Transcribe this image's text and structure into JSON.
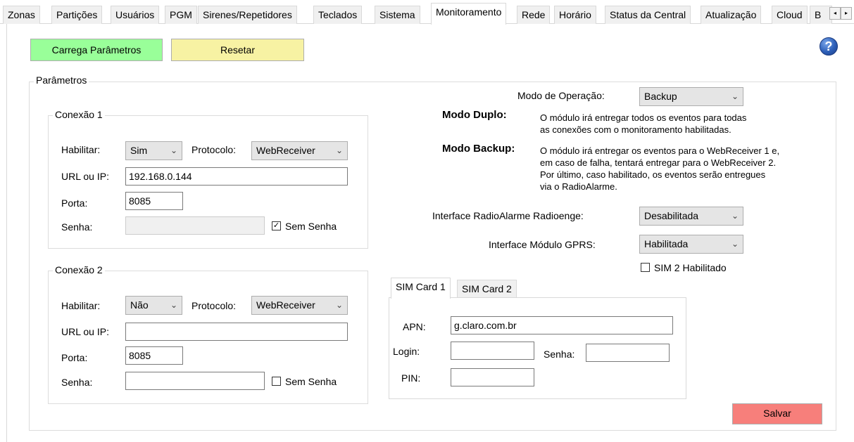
{
  "tabs": {
    "items": [
      "Zonas",
      "Partições",
      "Usuários",
      "PGM",
      "Sirenes/Repetidores",
      "Teclados",
      "Sistema",
      "Monitoramento",
      "Rede",
      "Horário",
      "Status da Central",
      "Atualização",
      "Cloud",
      "B"
    ],
    "active": "Monitoramento",
    "scroll_left": "◂",
    "scroll_right": "▸"
  },
  "toolbar": {
    "load_label": "Carrega Parâmetros",
    "reset_label": "Resetar",
    "help_label": "?"
  },
  "params": {
    "title": "Parâmetros"
  },
  "conn1": {
    "title": "Conexão 1",
    "enable_label": "Habilitar:",
    "enable_value": "Sim",
    "protocol_label": "Protocolo:",
    "protocol_value": "WebReceiver",
    "url_label": "URL ou IP:",
    "url_value": "192.168.0.144",
    "port_label": "Porta:",
    "port_value": "8085",
    "password_label": "Senha:",
    "password_value": "",
    "no_password_label": "Sem Senha",
    "no_password_checked": true
  },
  "conn2": {
    "title": "Conexão 2",
    "enable_label": "Habilitar:",
    "enable_value": "Não",
    "protocol_label": "Protocolo:",
    "protocol_value": "WebReceiver",
    "url_label": "URL ou IP:",
    "url_value": "",
    "port_label": "Porta:",
    "port_value": "8085",
    "password_label": "Senha:",
    "password_value": "",
    "no_password_label": "Sem Senha",
    "no_password_checked": false
  },
  "operation": {
    "mode_label": "Modo de Operação:",
    "mode_value": "Backup",
    "dual_title": "Modo Duplo:",
    "dual_line1": "O módulo irá entregar todos os eventos para todas",
    "dual_line2": "as conexões com o monitoramento habilitadas.",
    "backup_title": "Modo Backup:",
    "backup_line1": "O módulo irá entregar os eventos para o WebReceiver 1 e,",
    "backup_line2": "em caso de falha, tentará entregar para o WebReceiver 2.",
    "backup_line3": "Por último, caso habilitado, os eventos serão entregues",
    "backup_line4": "via o RadioAlarme."
  },
  "interfaces": {
    "radio_label": "Interface RadioAlarme Radioenge:",
    "radio_value": "Desabilitada",
    "gprs_label": "Interface Módulo GPRS:",
    "gprs_value": "Habilitada",
    "sim2_label": "SIM 2 Habilitado",
    "sim2_checked": false
  },
  "sim": {
    "tab1": "SIM Card 1",
    "tab2": "SIM Card 2",
    "apn_label": "APN:",
    "apn_value": "g.claro.com.br",
    "login_label": "Login:",
    "login_value": "",
    "password_label": "Senha:",
    "password_value": "",
    "pin_label": "PIN:",
    "pin_value": ""
  },
  "save_label": "Salvar",
  "colors": {
    "load_button": "#99ff99",
    "reset_button": "#f7f2a3",
    "save_button": "#f77f7b",
    "help_icon": "#2d5fb8"
  },
  "icons": {
    "dropdown": "chevron-down-icon",
    "help": "help-icon",
    "checkbox_checked": "checkmark-icon"
  }
}
